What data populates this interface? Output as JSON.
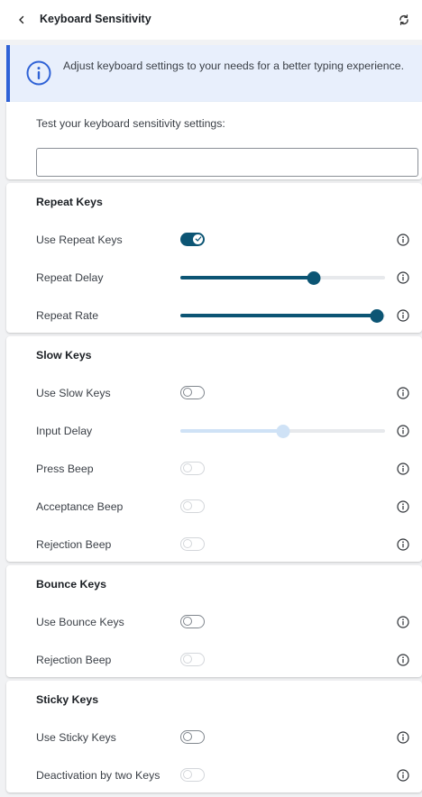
{
  "header": {
    "title": "Keyboard Sensitivity",
    "back_icon": "chevron-left-icon",
    "reset_icon": "refresh-icon"
  },
  "banner": {
    "icon": "info-icon",
    "text": "Adjust keyboard settings to your needs for a better typing experience."
  },
  "test": {
    "label": "Test your keyboard sensitivity settings:",
    "input_value": "",
    "input_placeholder": ""
  },
  "sections": {
    "repeat": {
      "title": "Repeat Keys",
      "use_label": "Use Repeat Keys",
      "use_enabled": true,
      "delay_label": "Repeat Delay",
      "delay_value": 0.65,
      "rate_label": "Repeat Rate",
      "rate_value": 0.96
    },
    "slow": {
      "title": "Slow Keys",
      "use_label": "Use Slow Keys",
      "use_enabled": false,
      "input_delay_label": "Input Delay",
      "input_delay_value": 0.5,
      "press_beep_label": "Press Beep",
      "acceptance_beep_label": "Acceptance Beep",
      "rejection_beep_label": "Rejection Beep"
    },
    "bounce": {
      "title": "Bounce Keys",
      "use_label": "Use Bounce Keys",
      "use_enabled": false,
      "rejection_beep_label": "Rejection Beep"
    },
    "sticky": {
      "title": "Sticky Keys",
      "use_label": "Use Sticky Keys",
      "use_enabled": false,
      "deactivation_label": "Deactivation by two Keys"
    }
  },
  "colors": {
    "accent": "#0c5574",
    "banner_bg": "#e8effc",
    "banner_border": "#2f62d6",
    "disabled_slider": "#cfe2f6"
  }
}
